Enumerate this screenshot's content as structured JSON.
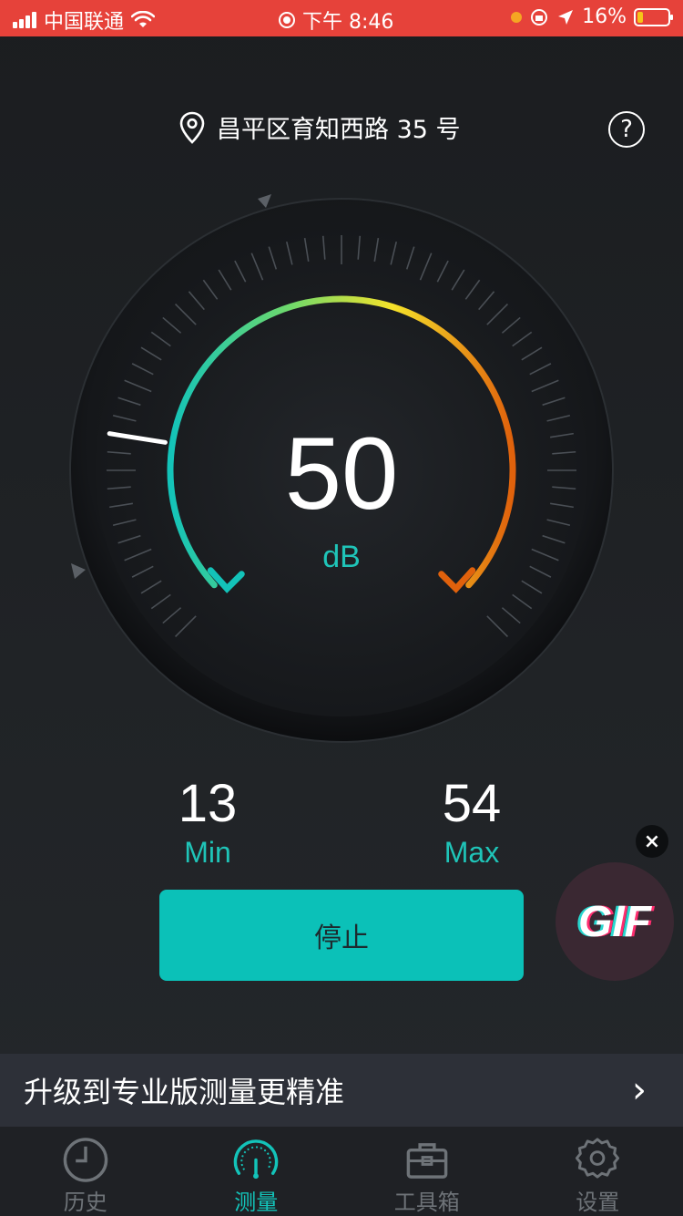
{
  "status_bar": {
    "carrier": "中国联通",
    "time": "下午 8:46",
    "battery_percent": "16%"
  },
  "header": {
    "location": "昌平区育知西路 35 号",
    "help_label": "?"
  },
  "gauge": {
    "value": "50",
    "unit": "dB",
    "level_fraction": 0.2
  },
  "stats": {
    "min_value": "13",
    "min_label": "Min",
    "max_value": "54",
    "max_label": "Max"
  },
  "controls": {
    "stop_label": "停止"
  },
  "gif_overlay": {
    "label": "GIF",
    "close_label": "×"
  },
  "upgrade": {
    "text": "升级到专业版测量更精准",
    "arrow": "›"
  },
  "tabs": [
    {
      "label": "历史",
      "icon": "clock-icon",
      "active": false
    },
    {
      "label": "测量",
      "icon": "gauge-icon",
      "active": true
    },
    {
      "label": "工具箱",
      "icon": "toolbox-icon",
      "active": false
    },
    {
      "label": "设置",
      "icon": "gear-icon",
      "active": false
    }
  ],
  "colors": {
    "status_bar": "#e6423a",
    "accent": "#0bc1b8",
    "arc_start": "#13c3b9",
    "arc_mid": "#f5e22a",
    "arc_end": "#e0610c"
  }
}
